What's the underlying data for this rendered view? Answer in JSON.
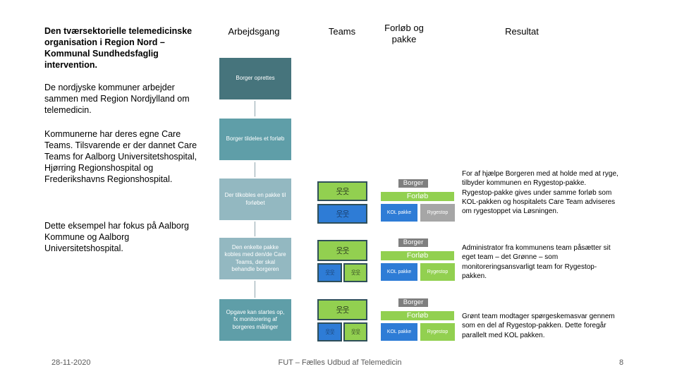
{
  "left": {
    "title": "Den tværsektorielle telemedicinske organisation i Region Nord – Kommunal Sundhedsfaglig intervention.",
    "paragraphs": [
      "De nordjyske kommuner arbejder sammen med Region Nordjylland om telemedicin.",
      "Kommunerne har deres egne Care Teams. Tilsvarende er der dannet Care Teams for Aalborg Universitetshospital, Hjørring Regionshospital og Frederikshavns Regionshospital.",
      "Dette eksempel har fokus på Aalborg Kommune og Aalborg Universitetshospital."
    ]
  },
  "columns": {
    "workflow": "Arbejdsgang",
    "teams": "Teams",
    "course": "Forløb og pakke",
    "result": "Resultat"
  },
  "workflow_steps": [
    {
      "label": "Borger oprettes",
      "color": "#46747c"
    },
    {
      "label": "Borger tildeles et forløb",
      "color": "#5f9ea8"
    },
    {
      "label": "Der tilkobles en pakke til forløbet",
      "color": "#93b8c1"
    },
    {
      "label": "Den enkelte pakke kobles med den/de Care Teams, der skal behandle borgeren",
      "color": "#93b8c1"
    },
    {
      "label": "Opgave kan startes op, fx monitorering af borgeres målinger",
      "color": "#5f9ea8"
    }
  ],
  "teams_icon": "people-icon",
  "teams_icon_glyph": "웃웃",
  "course_groups": [
    {
      "borger": "Borger",
      "forlob": "Forløb",
      "kol": "KOL pakke",
      "rygestop": "Rygestop",
      "rygestop_color": "#a6a6a6",
      "result": "For af hjælpe Borgeren med at holde med at ryge, tilbyder kommunen en Rygestop-pakke. Rygestop-pakke gives under samme forløb som KOL-pakken og hospitalets Care Team adviseres om rygestoppet via Løsningen."
    },
    {
      "borger": "Borger",
      "forlob": "Forløb",
      "kol": "KOL pakke",
      "rygestop": "Rygestop",
      "rygestop_color": "#92d050",
      "result": "Administrator fra kommunens team påsætter sit eget team – det Grønne – som monitoreringsansvarligt team for Rygestop-pakken."
    },
    {
      "borger": "Borger",
      "forlob": "Forløb",
      "kol": "KOL pakke",
      "rygestop": "Rygestop",
      "rygestop_color": "#92d050",
      "result": "Grønt team modtager spørgeskemasvar gennem som en del af Rygestop-pakken. Dette foregår parallelt med KOL pakken."
    }
  ],
  "colors": {
    "green_team": "#92d050",
    "blue_team": "#2e7cd6",
    "team_border": "#2f4f5a",
    "borger_tag": "#7f7f7f"
  },
  "footer": {
    "date": "28-11-2020",
    "center": "FUT – Fælles Udbud af Telemedicin",
    "page": "8"
  }
}
